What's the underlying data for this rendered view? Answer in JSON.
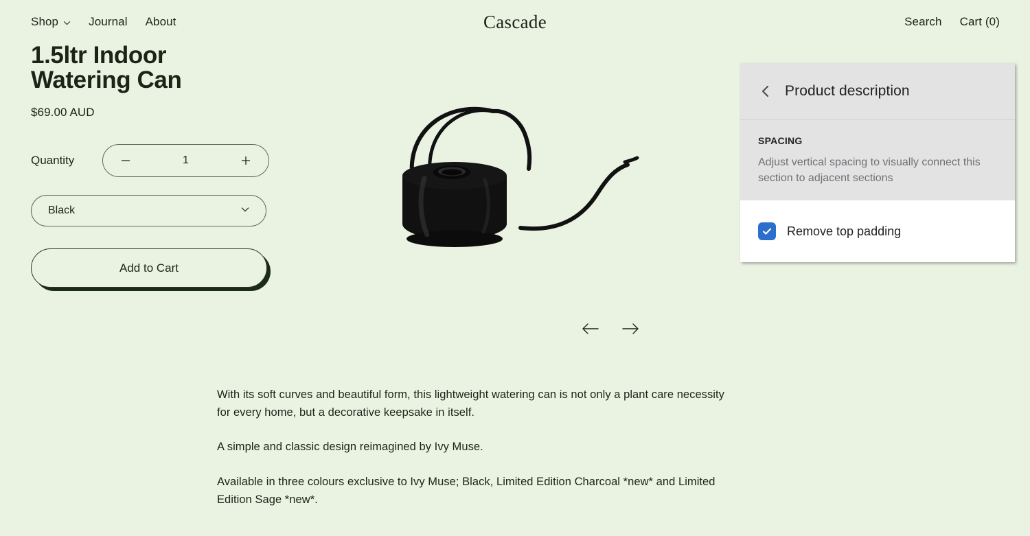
{
  "header": {
    "brand": "Cascade",
    "nav_left": [
      {
        "label": "Shop",
        "has_chevron": true,
        "icon": "chevron-down-icon"
      },
      {
        "label": "Journal",
        "has_chevron": false
      },
      {
        "label": "About",
        "has_chevron": false
      }
    ],
    "nav_right": [
      {
        "label": "Search",
        "name": "search"
      },
      {
        "label": "Cart (0)",
        "name": "cart"
      }
    ]
  },
  "product": {
    "title": "1.5ltr Indoor Watering Can",
    "price": "$69.00 AUD",
    "quantity_label": "Quantity",
    "quantity_value": "1",
    "decrease_icon": "minus-icon",
    "increase_icon": "plus-icon",
    "variant_selected": "Black",
    "variant_options": [
      "Black",
      "Limited Edition Charcoal",
      "Limited Edition Sage"
    ],
    "variant_icon": "chevron-down-icon",
    "add_to_cart_label": "Add to Cart",
    "image_alt": "black indoor watering can",
    "prev_icon": "arrow-left-icon",
    "next_icon": "arrow-right-icon",
    "description_paragraphs": [
      "With its soft curves and beautiful form, this lightweight watering can is not only a plant care necessity for every home, but a decorative keepsake in itself.",
      "A simple and classic design reimagined by Ivy Muse.",
      "Available in three colours exclusive to Ivy Muse; Black, Limited Edition Charcoal *new* and Limited Edition Sage *new*."
    ]
  },
  "editor_panel": {
    "back_icon": "chevron-left-icon",
    "title": "Product description",
    "section_label": "SPACING",
    "section_description": "Adjust vertical spacing to visually connect this section to adjacent sections",
    "checkbox": {
      "label": "Remove top padding",
      "checked": true,
      "icon": "check-icon"
    }
  },
  "colors": {
    "page_background": "#eaf2e2",
    "text": "#1a2417",
    "panel_background": "#e3e3e3",
    "panel_white": "#ffffff",
    "checkbox_accent": "#2c6ecb",
    "muted_text": "#6d7175",
    "product_black": "#111111"
  }
}
